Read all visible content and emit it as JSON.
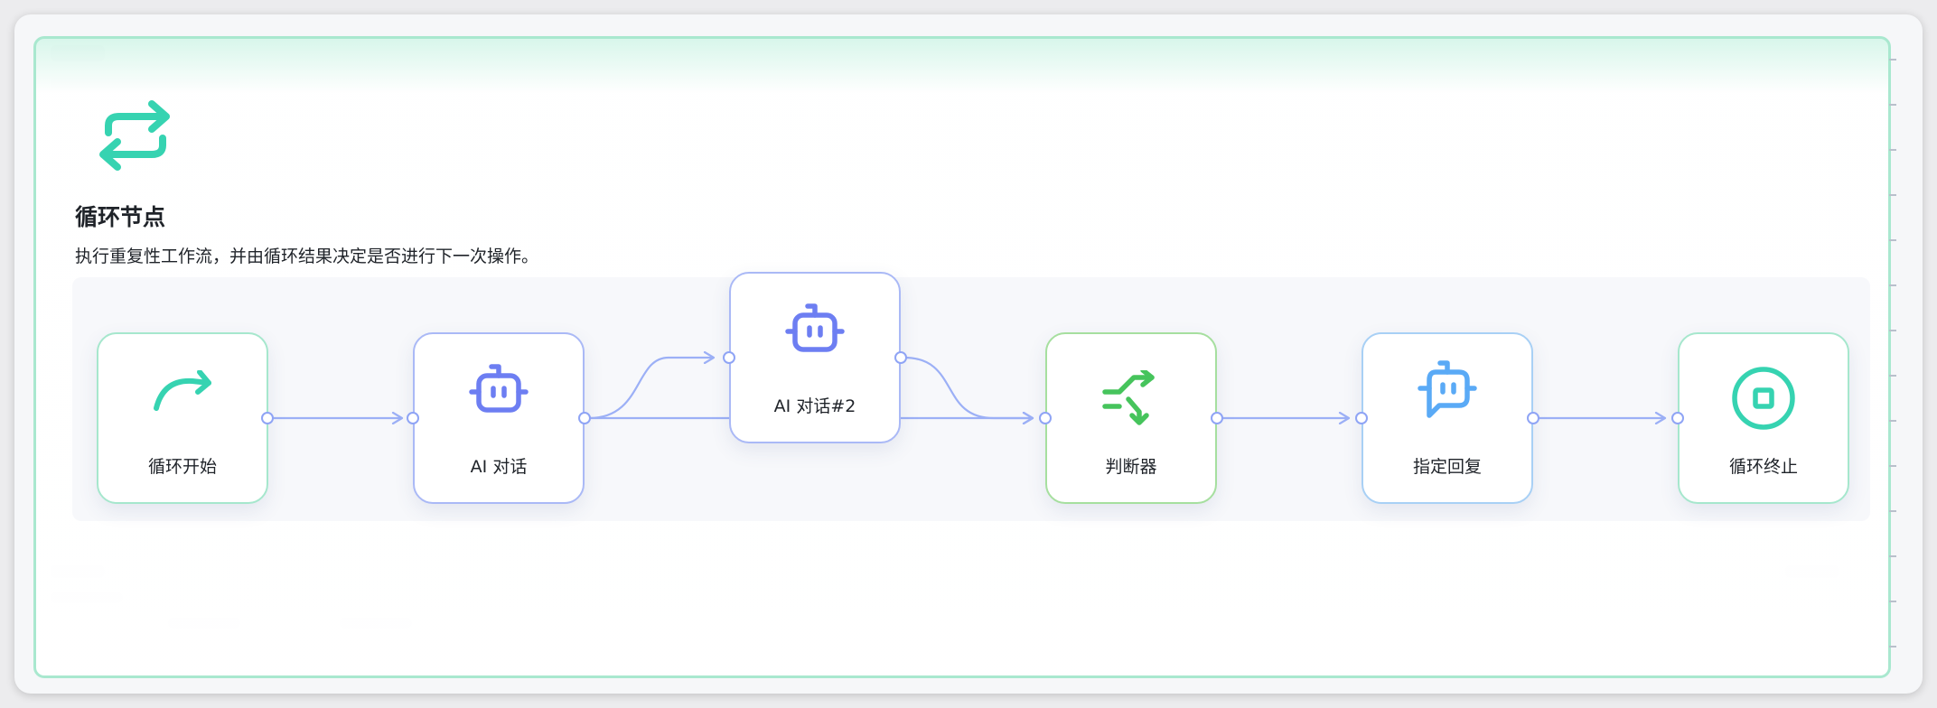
{
  "header": {
    "title": "循环节点",
    "description": "执行重复性工作流，并由循环结果决定是否进行下一次操作。",
    "icon": "loop-arrows-icon"
  },
  "nodes": [
    {
      "id": "loop-start",
      "label": "循环开始",
      "icon": "redo-arrow-icon",
      "color": "#36d3b1"
    },
    {
      "id": "ai-chat",
      "label": "AI 对话",
      "icon": "robot-icon",
      "color": "#6d7ef2"
    },
    {
      "id": "ai-chat-2",
      "label": "AI 对话#2",
      "icon": "robot-icon",
      "color": "#6d7ef2"
    },
    {
      "id": "judge",
      "label": "判断器",
      "icon": "branch-icon",
      "color": "#46c45c"
    },
    {
      "id": "reply",
      "label": "指定回复",
      "icon": "chat-robot-icon",
      "color": "#5aaaf6"
    },
    {
      "id": "loop-end",
      "label": "循环终止",
      "icon": "stop-circle-icon",
      "color": "#36d3b1"
    }
  ],
  "colors": {
    "accent_green": "#36d3b1",
    "edge_blue": "#9cb0f6",
    "card_border": "#a9e8cf"
  }
}
